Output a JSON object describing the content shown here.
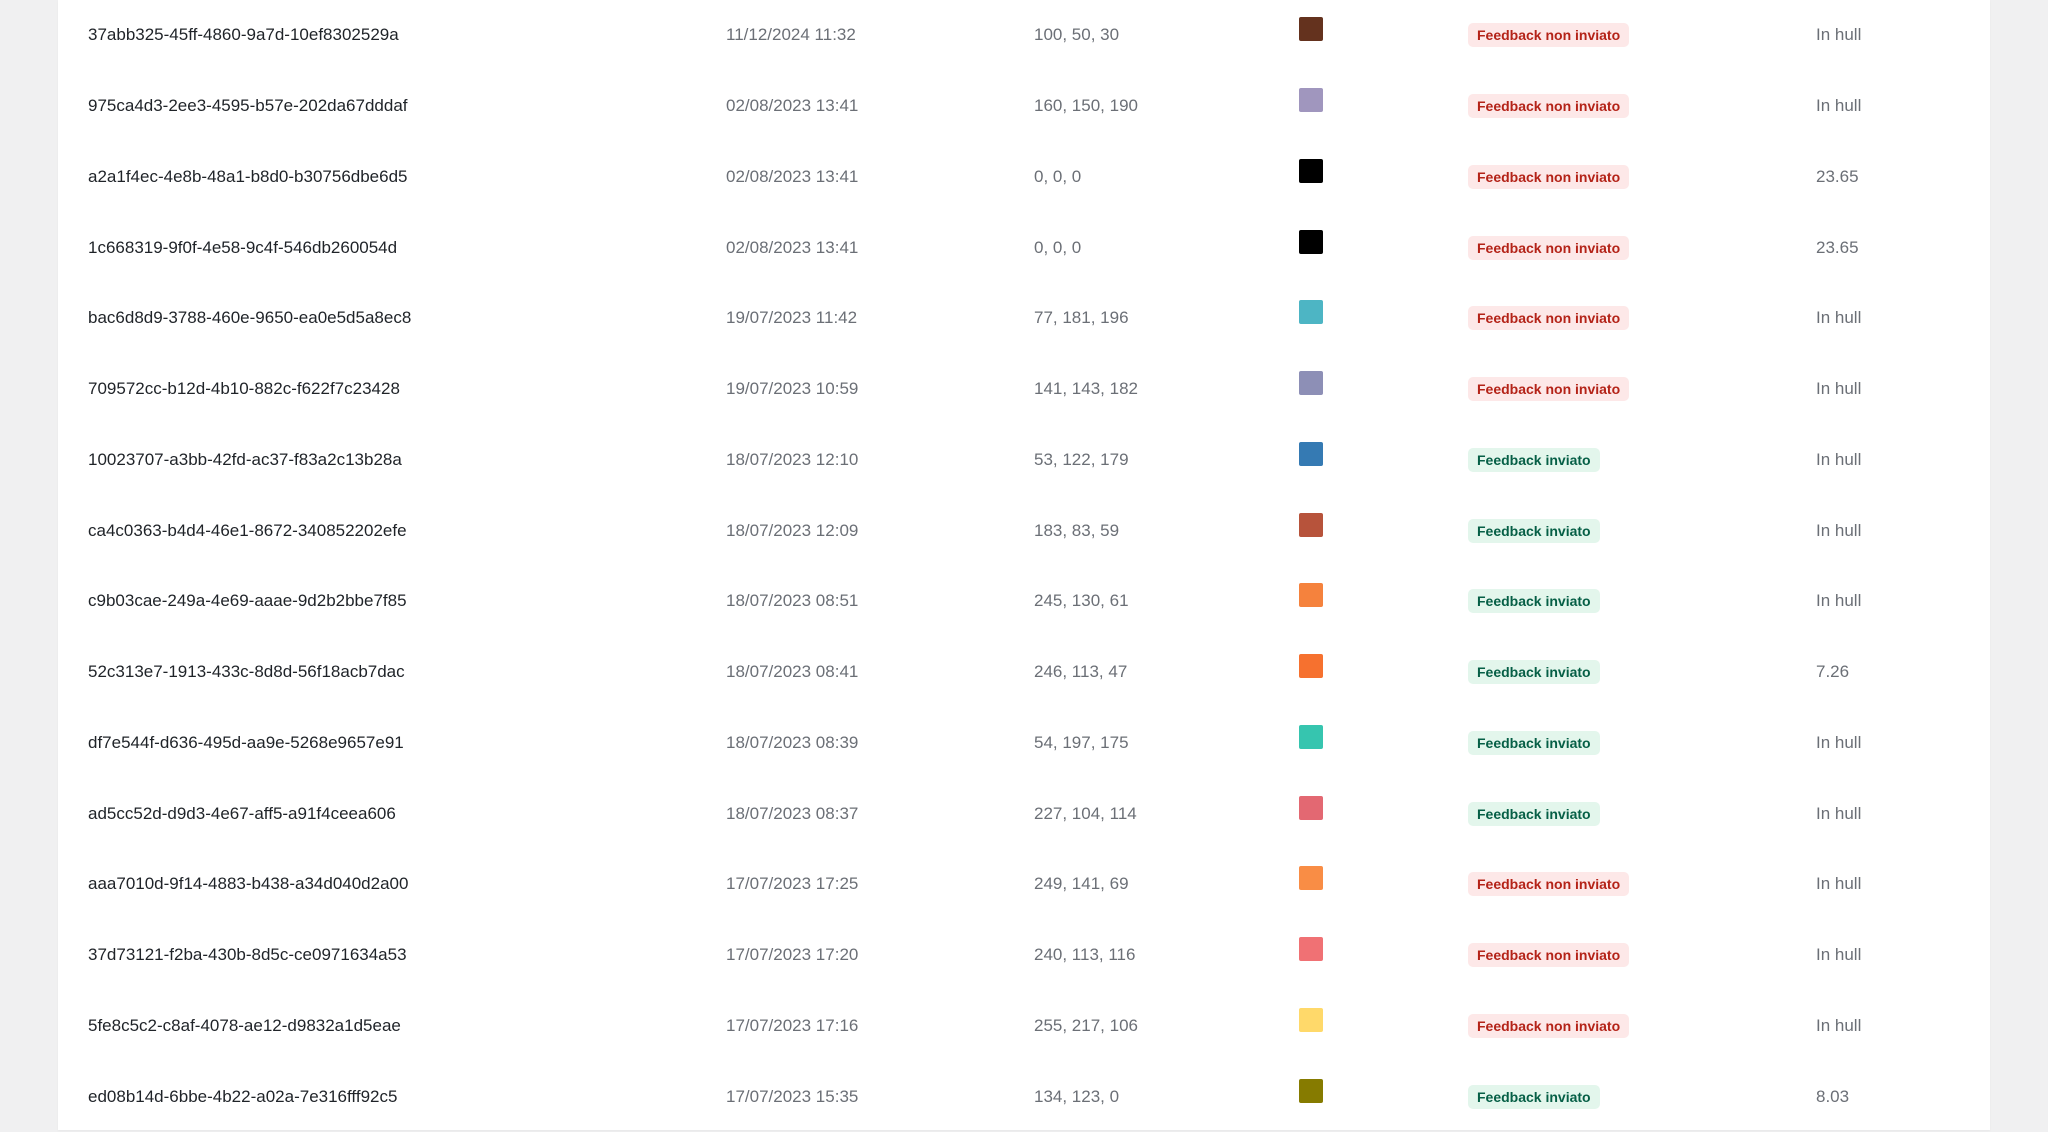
{
  "table": {
    "rows": [
      {
        "id": "37abb325-45ff-4860-9a7d-10ef8302529a",
        "date": "11/12/2024 11:32",
        "rgb": "100, 50, 30",
        "color": "#64321e",
        "status": "Feedback non inviato",
        "status_kind": "neg",
        "value": "In hull"
      },
      {
        "id": "975ca4d3-2ee3-4595-b57e-202da67dddaf",
        "date": "02/08/2023 13:41",
        "rgb": "160, 150, 190",
        "color": "#a096be",
        "status": "Feedback non inviato",
        "status_kind": "neg",
        "value": "In hull"
      },
      {
        "id": "a2a1f4ec-4e8b-48a1-b8d0-b30756dbe6d5",
        "date": "02/08/2023 13:41",
        "rgb": "0, 0, 0",
        "color": "#000000",
        "status": "Feedback non inviato",
        "status_kind": "neg",
        "value": "23.65"
      },
      {
        "id": "1c668319-9f0f-4e58-9c4f-546db260054d",
        "date": "02/08/2023 13:41",
        "rgb": "0, 0, 0",
        "color": "#000000",
        "status": "Feedback non inviato",
        "status_kind": "neg",
        "value": "23.65"
      },
      {
        "id": "bac6d8d9-3788-460e-9650-ea0e5d5a8ec8",
        "date": "19/07/2023 11:42",
        "rgb": "77, 181, 196",
        "color": "#4db5c4",
        "status": "Feedback non inviato",
        "status_kind": "neg",
        "value": "In hull"
      },
      {
        "id": "709572cc-b12d-4b10-882c-f622f7c23428",
        "date": "19/07/2023 10:59",
        "rgb": "141, 143, 182",
        "color": "#8d8fb6",
        "status": "Feedback non inviato",
        "status_kind": "neg",
        "value": "In hull"
      },
      {
        "id": "10023707-a3bb-42fd-ac37-f83a2c13b28a",
        "date": "18/07/2023 12:10",
        "rgb": "53, 122, 179",
        "color": "#357ab3",
        "status": "Feedback inviato",
        "status_kind": "pos",
        "value": "In hull"
      },
      {
        "id": "ca4c0363-b4d4-46e1-8672-340852202efe",
        "date": "18/07/2023 12:09",
        "rgb": "183, 83, 59",
        "color": "#b7533b",
        "status": "Feedback inviato",
        "status_kind": "pos",
        "value": "In hull"
      },
      {
        "id": "c9b03cae-249a-4e69-aaae-9d2b2bbe7f85",
        "date": "18/07/2023 08:51",
        "rgb": "245, 130, 61",
        "color": "#f5823d",
        "status": "Feedback inviato",
        "status_kind": "pos",
        "value": "In hull"
      },
      {
        "id": "52c313e7-1913-433c-8d8d-56f18acb7dac",
        "date": "18/07/2023 08:41",
        "rgb": "246, 113, 47",
        "color": "#f6712f",
        "status": "Feedback inviato",
        "status_kind": "pos",
        "value": "7.26"
      },
      {
        "id": "df7e544f-d636-495d-aa9e-5268e9657e91",
        "date": "18/07/2023 08:39",
        "rgb": "54, 197, 175",
        "color": "#36c5af",
        "status": "Feedback inviato",
        "status_kind": "pos",
        "value": "In hull"
      },
      {
        "id": "ad5cc52d-d9d3-4e67-aff5-a91f4ceea606",
        "date": "18/07/2023 08:37",
        "rgb": "227, 104, 114",
        "color": "#e36872",
        "status": "Feedback inviato",
        "status_kind": "pos",
        "value": "In hull"
      },
      {
        "id": "aaa7010d-9f14-4883-b438-a34d040d2a00",
        "date": "17/07/2023 17:25",
        "rgb": "249, 141, 69",
        "color": "#f98d45",
        "status": "Feedback non inviato",
        "status_kind": "neg",
        "value": "In hull"
      },
      {
        "id": "37d73121-f2ba-430b-8d5c-ce0971634a53",
        "date": "17/07/2023 17:20",
        "rgb": "240, 113, 116",
        "color": "#f07174",
        "status": "Feedback non inviato",
        "status_kind": "neg",
        "value": "In hull"
      },
      {
        "id": "5fe8c5c2-c8af-4078-ae12-d9832a1d5eae",
        "date": "17/07/2023 17:16",
        "rgb": "255, 217, 106",
        "color": "#ffd96a",
        "status": "Feedback non inviato",
        "status_kind": "neg",
        "value": "In hull"
      },
      {
        "id": "ed08b14d-6bbe-4b22-a02a-7e316fff92c5",
        "date": "17/07/2023 15:35",
        "rgb": "134, 123, 0",
        "color": "#867b00",
        "status": "Feedback inviato",
        "status_kind": "pos",
        "value": "8.03"
      }
    ]
  }
}
